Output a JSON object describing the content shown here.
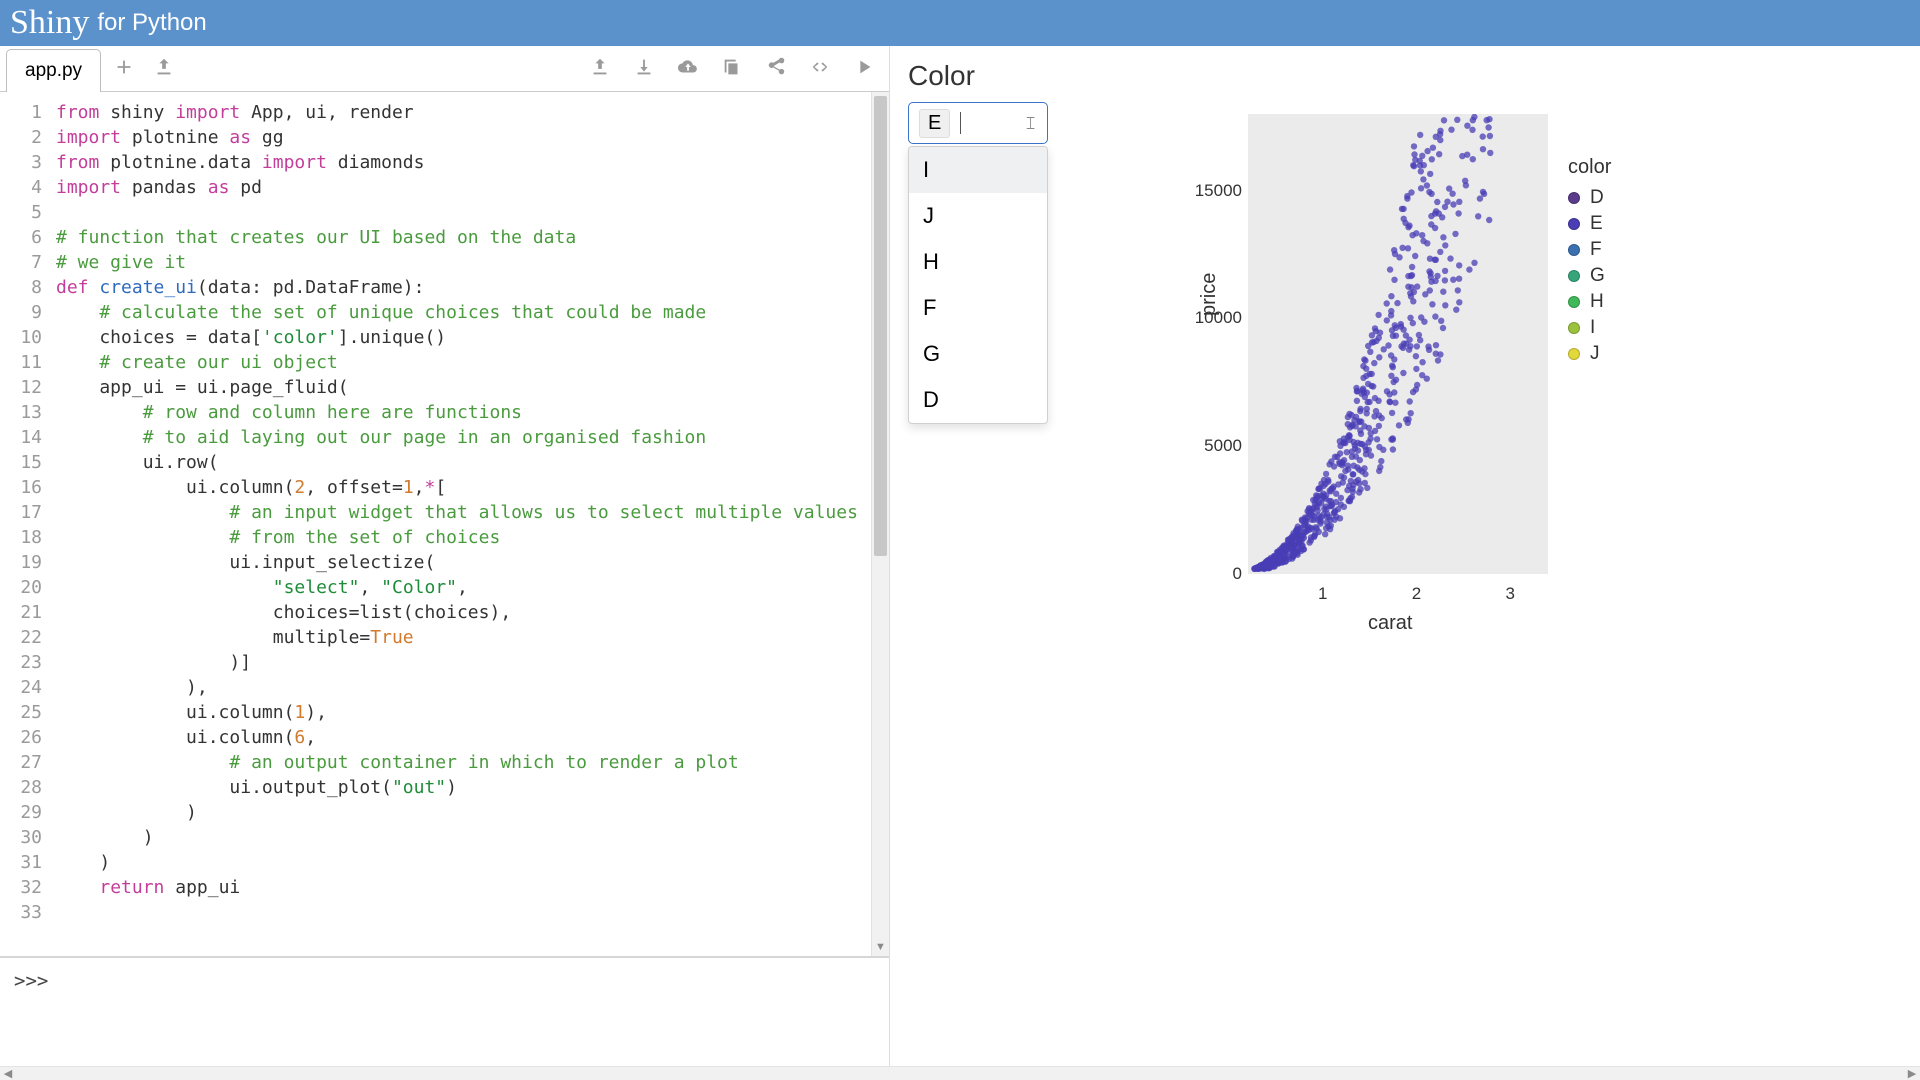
{
  "header": {
    "logo": "Shiny",
    "subtitle": "for Python"
  },
  "tabs": {
    "active": "app.py"
  },
  "toolbar_icons": [
    "add-icon",
    "upload-icon"
  ],
  "toolbar_right_icons": [
    "upload-file-icon",
    "download-icon",
    "cloud-download-icon",
    "copy-icon",
    "share-icon",
    "code-icon",
    "play-icon"
  ],
  "console": {
    "prompt": ">>>"
  },
  "code_lines": [
    [
      {
        "t": "from",
        "c": "kw"
      },
      {
        "t": " shiny "
      },
      {
        "t": "import",
        "c": "kw"
      },
      {
        "t": " App, ui, render"
      }
    ],
    [
      {
        "t": "import",
        "c": "kw"
      },
      {
        "t": " plotnine "
      },
      {
        "t": "as",
        "c": "kw"
      },
      {
        "t": " gg"
      }
    ],
    [
      {
        "t": "from",
        "c": "kw"
      },
      {
        "t": " plotnine.data "
      },
      {
        "t": "import",
        "c": "kw"
      },
      {
        "t": " diamonds"
      }
    ],
    [
      {
        "t": "import",
        "c": "kw"
      },
      {
        "t": " pandas "
      },
      {
        "t": "as",
        "c": "kw"
      },
      {
        "t": " pd"
      }
    ],
    [
      {
        "t": ""
      }
    ],
    [
      {
        "t": "# function that creates our UI based on the data",
        "c": "cm"
      }
    ],
    [
      {
        "t": "# we give it",
        "c": "cm"
      }
    ],
    [
      {
        "t": "def ",
        "c": "kw"
      },
      {
        "t": "create_ui",
        "c": "fn"
      },
      {
        "t": "(data: pd.DataFrame):"
      }
    ],
    [
      {
        "t": "    "
      },
      {
        "t": "# calculate the set of unique choices that could be made",
        "c": "cm"
      }
    ],
    [
      {
        "t": "    choices = data["
      },
      {
        "t": "'color'",
        "c": "str"
      },
      {
        "t": "].unique()"
      }
    ],
    [
      {
        "t": "    "
      },
      {
        "t": "# create our ui object",
        "c": "cm"
      }
    ],
    [
      {
        "t": "    app_ui = ui.page_fluid("
      }
    ],
    [
      {
        "t": "        "
      },
      {
        "t": "# row and column here are functions",
        "c": "cm"
      }
    ],
    [
      {
        "t": "        "
      },
      {
        "t": "# to aid laying out our page in an organised fashion",
        "c": "cm"
      }
    ],
    [
      {
        "t": "        ui.row("
      }
    ],
    [
      {
        "t": "            ui.column("
      },
      {
        "t": "2",
        "c": "num"
      },
      {
        "t": ", offset="
      },
      {
        "t": "1",
        "c": "num"
      },
      {
        "t": ","
      },
      {
        "t": "*",
        "c": "kw"
      },
      {
        "t": "["
      }
    ],
    [
      {
        "t": "                "
      },
      {
        "t": "# an input widget that allows us to select multiple values",
        "c": "cm"
      }
    ],
    [
      {
        "t": "                "
      },
      {
        "t": "# from the set of choices",
        "c": "cm"
      }
    ],
    [
      {
        "t": "                ui.input_selectize("
      }
    ],
    [
      {
        "t": "                    "
      },
      {
        "t": "\"select\"",
        "c": "str"
      },
      {
        "t": ", "
      },
      {
        "t": "\"Color\"",
        "c": "str"
      },
      {
        "t": ","
      }
    ],
    [
      {
        "t": "                    choices=list(choices),"
      }
    ],
    [
      {
        "t": "                    multiple="
      },
      {
        "t": "True",
        "c": "num"
      }
    ],
    [
      {
        "t": "                )]"
      }
    ],
    [
      {
        "t": "            ),"
      }
    ],
    [
      {
        "t": "            ui.column("
      },
      {
        "t": "1",
        "c": "num"
      },
      {
        "t": "),"
      }
    ],
    [
      {
        "t": "            ui.column("
      },
      {
        "t": "6",
        "c": "num"
      },
      {
        "t": ","
      }
    ],
    [
      {
        "t": "                "
      },
      {
        "t": "# an output container in which to render a plot",
        "c": "cm"
      }
    ],
    [
      {
        "t": "                ui.output_plot("
      },
      {
        "t": "\"out\"",
        "c": "str"
      },
      {
        "t": ")"
      }
    ],
    [
      {
        "t": "            )"
      }
    ],
    [
      {
        "t": "        )"
      }
    ],
    [
      {
        "t": "    )"
      }
    ],
    [
      {
        "t": "    "
      },
      {
        "t": "return",
        "c": "kw"
      },
      {
        "t": " app_ui"
      }
    ],
    [
      {
        "t": ""
      }
    ]
  ],
  "app": {
    "title": "Color",
    "select": {
      "value": "E",
      "options": [
        "I",
        "J",
        "H",
        "F",
        "G",
        "D"
      ],
      "highlight_index": 0
    }
  },
  "chart_data": {
    "type": "scatter",
    "xlabel": "carat",
    "ylabel": "price",
    "xlim": [
      0.2,
      3.4
    ],
    "ylim": [
      0,
      18000
    ],
    "xticks": [
      1,
      2,
      3
    ],
    "yticks": [
      0,
      5000,
      10000,
      15000
    ],
    "legend_title": "color",
    "series": [
      {
        "name": "D",
        "color": "#5a3b8c"
      },
      {
        "name": "E",
        "color": "#4a3db5"
      },
      {
        "name": "F",
        "color": "#3a6fb0"
      },
      {
        "name": "G",
        "color": "#36a67a"
      },
      {
        "name": "H",
        "color": "#3fb858"
      },
      {
        "name": "I",
        "color": "#9ac23c"
      },
      {
        "name": "J",
        "color": "#e2d83a"
      }
    ],
    "dominant_series": "E",
    "point_cloud_hint": "dense purple scatter rising superlinearly from (0.3, 500) to (2.5, 18000); most points concentrated between carat 0.5–1.5"
  }
}
